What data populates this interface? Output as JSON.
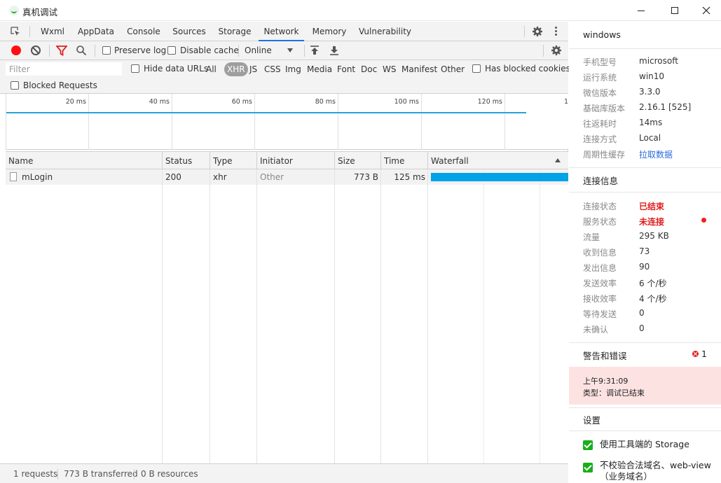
{
  "window": {
    "title": "真机调试"
  },
  "tabs": [
    {
      "label": "Wxml"
    },
    {
      "label": "AppData"
    },
    {
      "label": "Console"
    },
    {
      "label": "Sources"
    },
    {
      "label": "Storage"
    },
    {
      "label": "Network",
      "active": true
    },
    {
      "label": "Memory"
    },
    {
      "label": "Vulnerability"
    }
  ],
  "toolbar": {
    "preserve_log": "Preserve log",
    "disable_cache": "Disable cache",
    "throttle": "Online"
  },
  "filterbar": {
    "placeholder": "Filter",
    "hide_data_urls": "Hide data URLs",
    "types": [
      "All",
      "XHR",
      "JS",
      "CSS",
      "Img",
      "Media",
      "Font",
      "Doc",
      "WS",
      "Manifest",
      "Other"
    ],
    "active_type": "XHR",
    "has_blocked_cookies": "Has blocked cookies",
    "blocked_requests": "Blocked Requests"
  },
  "overview": {
    "ticks": [
      "20 ms",
      "40 ms",
      "60 ms",
      "80 ms",
      "100 ms",
      "120 ms",
      "1"
    ]
  },
  "table": {
    "columns": [
      "Name",
      "Status",
      "Type",
      "Initiator",
      "Size",
      "Time",
      "Waterfall"
    ],
    "rows": [
      {
        "name": "mLogin",
        "status": "200",
        "type": "xhr",
        "initiator": "Other",
        "size": "773 B",
        "time": "125 ms"
      }
    ]
  },
  "status": {
    "requests": "1 requests",
    "transferred": "773 B transferred",
    "resources": "0 B resources"
  },
  "device": {
    "title": "windows",
    "rows": [
      {
        "key": "手机型号",
        "value": "microsoft"
      },
      {
        "key": "运行系统",
        "value": "win10"
      },
      {
        "key": "微信版本",
        "value": "3.3.0"
      },
      {
        "key": "基础库版本",
        "value": "2.16.1 [525]"
      },
      {
        "key": "往返耗时",
        "value": "14ms"
      },
      {
        "key": "连接方式",
        "value": "Local"
      },
      {
        "key": "周期性缓存",
        "value": "拉取数据"
      }
    ]
  },
  "connection": {
    "title": "连接信息",
    "rows": [
      {
        "key": "连接状态",
        "value": "已结束"
      },
      {
        "key": "服务状态",
        "value": "未连接"
      },
      {
        "key": "流量",
        "value": "295 KB"
      },
      {
        "key": "收到信息",
        "value": "73"
      },
      {
        "key": "发出信息",
        "value": "90"
      },
      {
        "key": "发送效率",
        "value": "6 个/秒"
      },
      {
        "key": "接收效率",
        "value": "4 个/秒"
      },
      {
        "key": "等待发送",
        "value": "0"
      },
      {
        "key": "未确认",
        "value": "0"
      }
    ]
  },
  "warnings": {
    "title": "警告和错误",
    "count": "1",
    "time": "上午9:31:09",
    "message": "类型：调试已结束"
  },
  "settings": {
    "title": "设置",
    "items": [
      {
        "label": "使用工具端的 Storage",
        "checked": true
      },
      {
        "label": "不校验合法域名、web-view（业务域名）",
        "checked": true
      }
    ]
  },
  "colors": {
    "accent": "#1a73e8",
    "record": "#ff1111",
    "waterfall": "#00a2e8",
    "error": "#e02020",
    "check": "#1aad19"
  }
}
